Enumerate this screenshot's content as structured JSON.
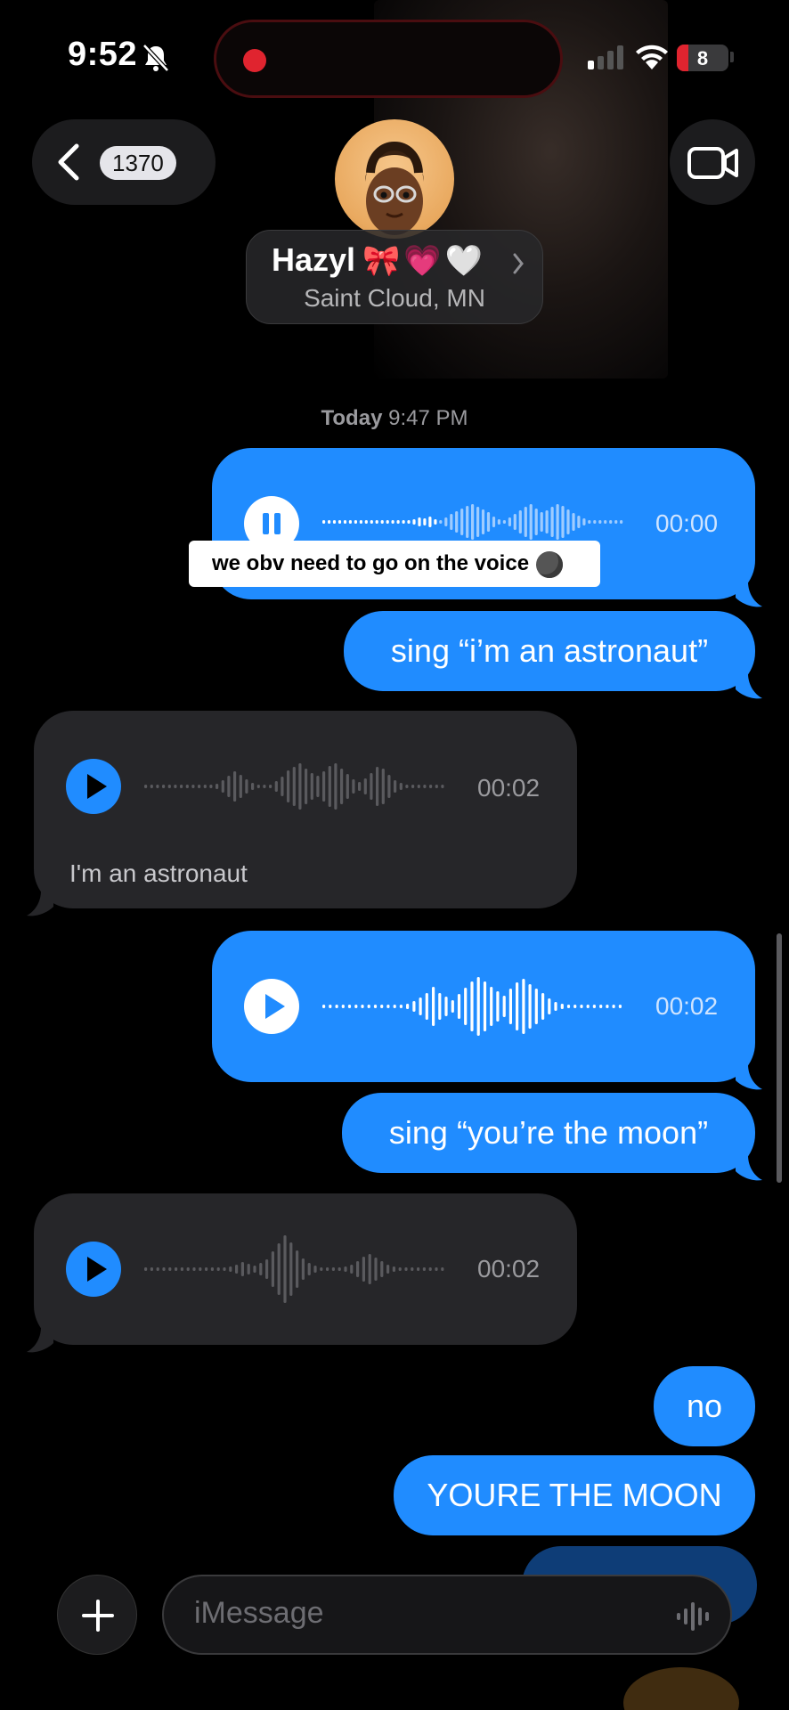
{
  "status_bar": {
    "time": "9:52",
    "battery_level": "8",
    "icons": [
      "bell-slash-icon",
      "signal-icon",
      "wifi-icon",
      "battery-icon"
    ],
    "recording_indicator_color": "#e0242f"
  },
  "header": {
    "back_badge": "1370",
    "contact_name": "Hazyl",
    "contact_emoji": "🎀💗🤍",
    "contact_location": "Saint Cloud, MN",
    "icons": [
      "chevron-left-icon",
      "video-camera-icon",
      "chevron-right-icon"
    ]
  },
  "chat": {
    "timestamp_day": "Today",
    "timestamp_time": "9:47 PM",
    "messages": [
      {
        "type": "audio",
        "from": "me",
        "state": "playing",
        "duration": "00:00"
      },
      {
        "type": "text",
        "from": "me",
        "text": "sing “i’m an astronaut”"
      },
      {
        "type": "audio",
        "from": "them",
        "duration": "00:02",
        "transcript": "I'm an astronaut"
      },
      {
        "type": "audio",
        "from": "me",
        "duration": "00:02"
      },
      {
        "type": "text",
        "from": "me",
        "text": "sing “you’re the moon”"
      },
      {
        "type": "audio",
        "from": "them",
        "duration": "00:02"
      },
      {
        "type": "text",
        "from": "me",
        "text": "no"
      },
      {
        "type": "text",
        "from": "me",
        "text": "YOURE THE MOON"
      }
    ]
  },
  "overlay_caption": "we obv need to go on the voice",
  "input": {
    "placeholder": "iMessage"
  },
  "colors": {
    "sent_bubble": "#208cff",
    "received_bubble": "#262629",
    "background": "#000000"
  }
}
